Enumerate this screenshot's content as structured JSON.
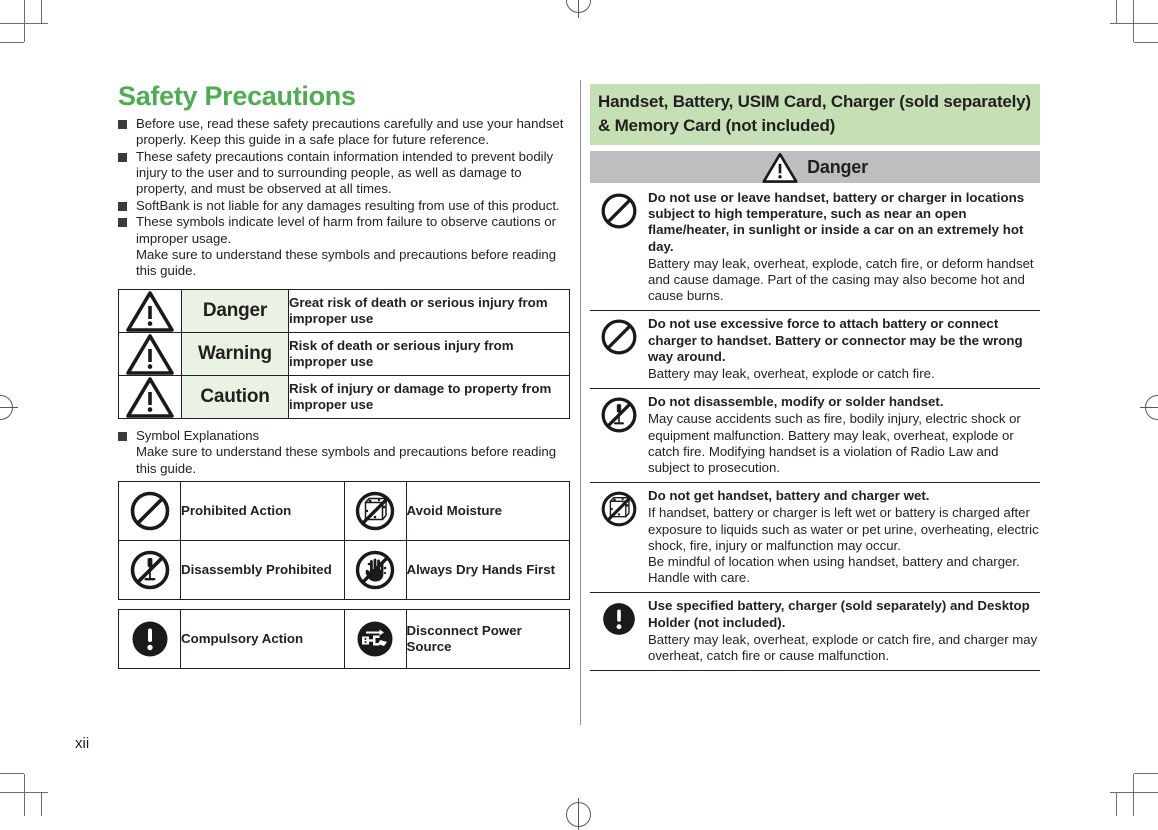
{
  "document": {
    "page_number": "xii",
    "colors": {
      "title_green": "#4caf4f",
      "section_header_green": "#c5e0b4",
      "danger_bar_gray": "#bcbec0",
      "level_name_bg": "#eaf3e3",
      "text": "#231f20"
    }
  },
  "left": {
    "title": "Safety Precautions",
    "bullets": [
      "Before use, read these safety precautions carefully and use your handset properly. Keep this guide in a safe place for future reference.",
      "These safety precautions contain information intended to prevent bodily injury to the user and to surrounding people, as well as damage to property, and must be observed at all times.",
      "SoftBank is not liable for any damages resulting from use of this product.",
      "These symbols indicate level of harm from failure to observe cautions or improper usage."
    ],
    "bullet4_sub": "Make sure to understand these symbols and precautions before reading this guide.",
    "level_table": [
      {
        "icon": "warning-triangle-icon",
        "name": "Danger",
        "description": "Great risk of death or serious injury from improper use"
      },
      {
        "icon": "warning-triangle-icon",
        "name": "Warning",
        "description": "Risk of death or serious injury from improper use"
      },
      {
        "icon": "warning-triangle-icon",
        "name": "Caution",
        "description": "Risk of injury or damage to property from improper use"
      }
    ],
    "symbol_head": "Symbol Explanations",
    "symbol_sub": "Make sure to understand these symbols and precautions before reading this guide.",
    "symbol_table_1": [
      {
        "icon": "prohibited-icon",
        "label": "Prohibited Action"
      },
      {
        "icon": "avoid-moisture-icon",
        "label": "Avoid Moisture"
      },
      {
        "icon": "disassembly-prohibited-icon",
        "label": "Disassembly Prohibited"
      },
      {
        "icon": "wet-hands-prohibited-icon",
        "label": "Always Dry Hands First"
      }
    ],
    "symbol_table_2": [
      {
        "icon": "compulsory-action-icon",
        "label": "Compulsory Action"
      },
      {
        "icon": "disconnect-power-icon",
        "label": "Disconnect Power Source"
      }
    ]
  },
  "right": {
    "section_title": "Handset, Battery, USIM Card, Charger (sold separately) & Memory Card (not included)",
    "danger_bar_label": "Danger",
    "danger_bar_icon": "warning-triangle-icon",
    "entries": [
      {
        "icon": "prohibited-icon",
        "title": "Do not use or leave handset, battery or charger in locations subject to high temperature, such as near an open flame/heater, in sunlight or inside a car on an extremely hot day.",
        "text": "Battery may leak, overheat, explode, catch fire, or deform handset and cause damage. Part of the casing may also become hot and cause burns."
      },
      {
        "icon": "prohibited-icon",
        "title": "Do not use excessive force to attach battery or connect charger to handset. Battery or connector may be the wrong way around.",
        "text": "Battery may leak, overheat, explode or catch fire."
      },
      {
        "icon": "disassembly-prohibited-icon",
        "title": "Do not disassemble, modify or solder handset.",
        "text": "May cause accidents such as fire, bodily injury, electric shock or equipment malfunction. Battery may leak, overheat, explode or catch fire. Modifying handset is a violation of Radio Law and subject to prosecution."
      },
      {
        "icon": "avoid-moisture-icon",
        "title": "Do not get handset, battery and charger wet.",
        "text": "If handset, battery or charger is left wet or battery is charged after exposure to liquids such as water or pet urine, overheating, electric shock, fire, injury or malfunction may occur.",
        "text2": "Be mindful of location when using handset, battery and charger. Handle with care."
      },
      {
        "icon": "compulsory-action-icon",
        "title": "Use specified battery, charger (sold separately) and Desktop Holder (not included).",
        "text": "Battery may leak, overheat, explode or catch fire, and charger may overheat, catch fire or cause malfunction."
      }
    ]
  }
}
